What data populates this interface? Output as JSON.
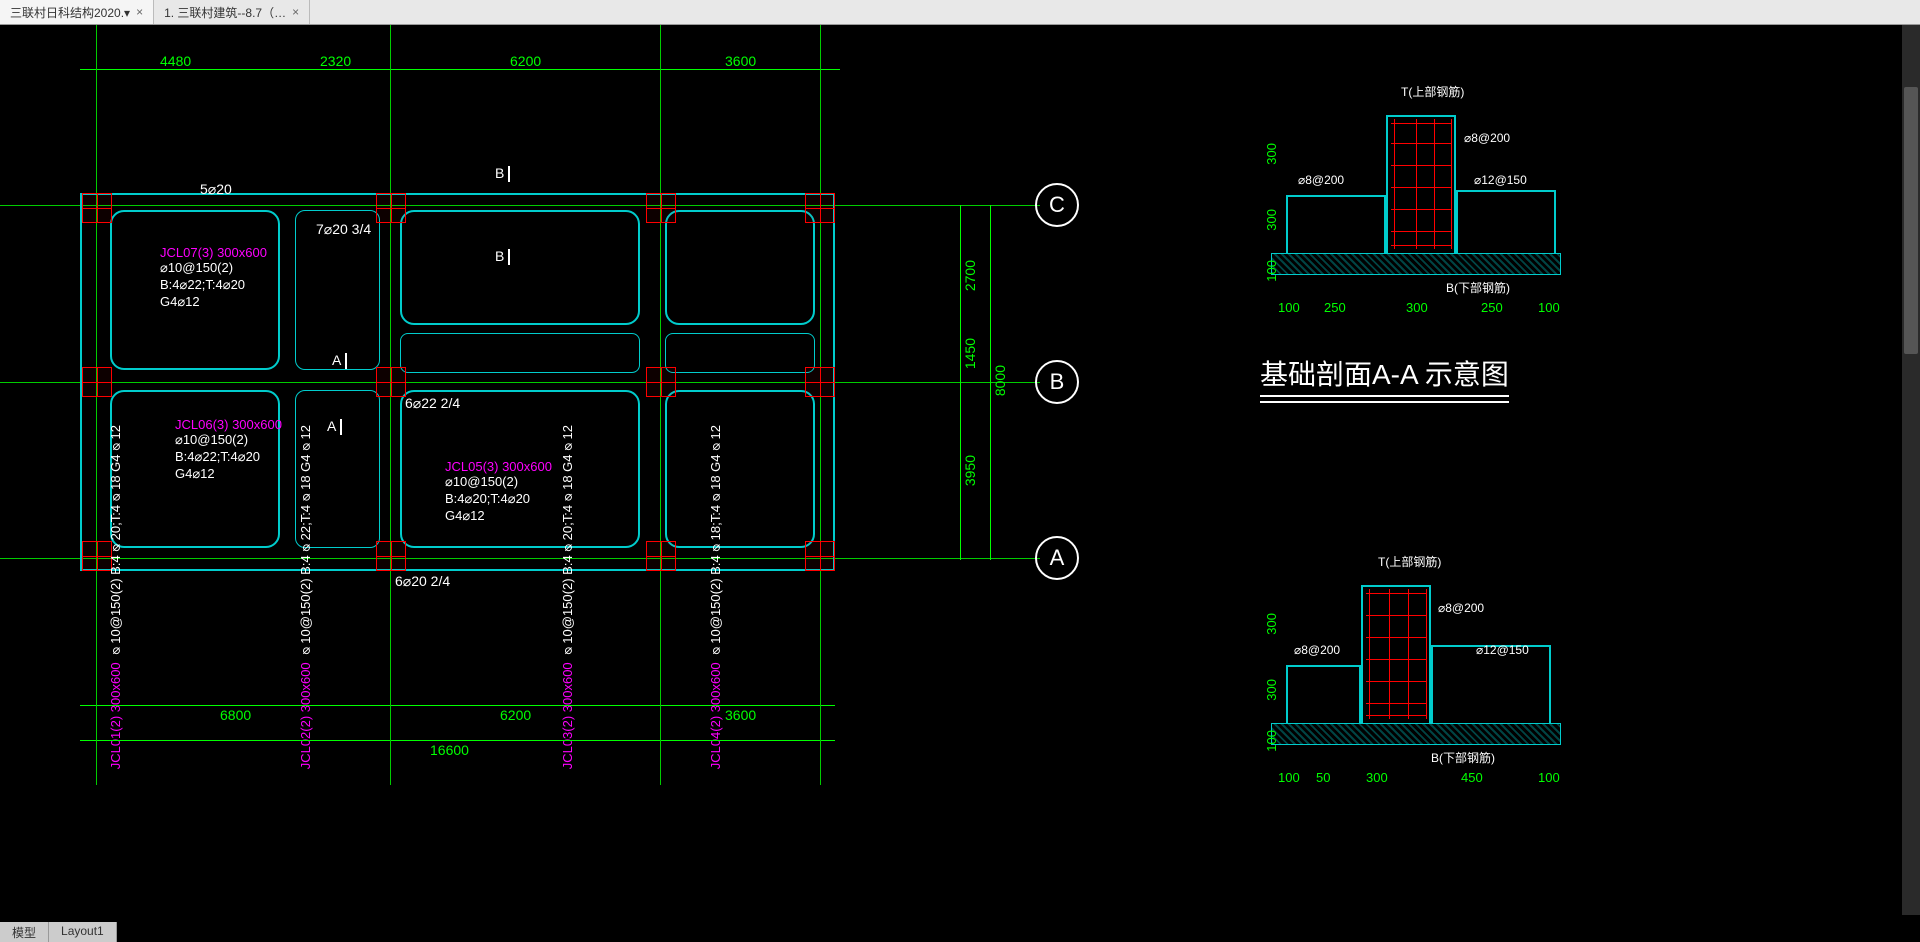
{
  "tabs": [
    {
      "label": "三联村日科结构2020.▾",
      "active": true
    },
    {
      "label": "1. 三联村建筑--8.7（…"
    }
  ],
  "bottom_tabs": [
    "模型",
    "Layout1"
  ],
  "top_dims": {
    "d1": "4480",
    "d2": "2320",
    "d3": "6200",
    "d4": "3600"
  },
  "left_notes": {
    "bar1": "5⌀20"
  },
  "right_v_dims": {
    "d1": "2700",
    "d2": "1450",
    "d3": "3950",
    "total": "8000"
  },
  "bottom_dims": {
    "d1": "6800",
    "d2": "6200",
    "d3": "3600",
    "total": "16600"
  },
  "axes": {
    "A": "A",
    "B": "B",
    "C": "C"
  },
  "jcl07": {
    "title": "JCL07(3) 300x600",
    "l1": "⌀10@150(2)",
    "l2": "B:4⌀22;T:4⌀20",
    "l3": "G4⌀12"
  },
  "jcl06": {
    "title": "JCL06(3) 300x600",
    "l1": "⌀10@150(2)",
    "l2": "B:4⌀22;T:4⌀20",
    "l3": "G4⌀12"
  },
  "jcl05": {
    "title": "JCL05(3) 300x600",
    "l1": "⌀10@150(2)",
    "l2": "B:4⌀20;T:4⌀20",
    "l3": "G4⌀12"
  },
  "jcl01": {
    "title": "JCL01(2) 300x600",
    "l1": "⌀10@150(2)",
    "l2": "B:4⌀20;T:4⌀18",
    "l3": "G4⌀12"
  },
  "jcl02": {
    "title": "JCL02(2) 300x600",
    "l1": "⌀10@150(2)",
    "l2": "B:4⌀22;T:4⌀18",
    "l3": "G4⌀12"
  },
  "jcl03": {
    "title": "JCL03(2) 300x600",
    "l1": "⌀10@150(2)",
    "l2": "B:4⌀20;T:4⌀18",
    "l3": "G4⌀12"
  },
  "jcl04": {
    "title": "JCL04(2) 300x600",
    "l1": "⌀10@150(2)",
    "l2": "B:4⌀18;T:4⌀18",
    "l3": "G4⌀12"
  },
  "rebar_notes": {
    "top": "7⌀20 3/4",
    "mid": "6⌀22 2/4",
    "bot": "6⌀20 2/4"
  },
  "sec_markers": {
    "B": "B",
    "A": "A"
  },
  "detail": {
    "title": "基础剖面A-A 示意图",
    "t_label": "T(上部钢筋)",
    "b_label": "B(下部钢筋)",
    "n1": "⌀8@200",
    "n2": "⌀8@200",
    "n3": "⌀12@150",
    "vh": "300",
    "vh2": "300",
    "vh3": "100",
    "bh": "100",
    "bh1": "250",
    "bh2": "300",
    "bh3": "250",
    "bh4": "100",
    "b2h": "100",
    "b2h1": "50",
    "b2h2": "300",
    "b2h3": "450",
    "b2h4": "100"
  }
}
